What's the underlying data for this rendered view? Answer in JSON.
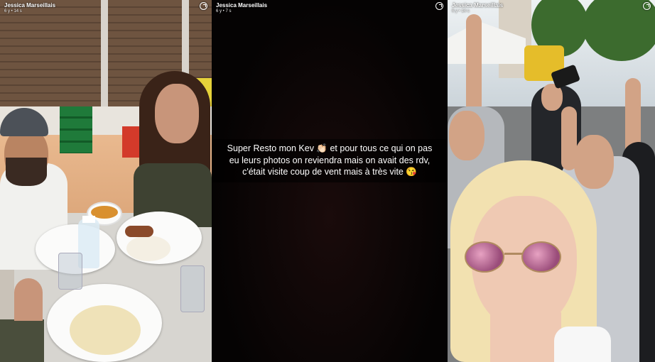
{
  "stories": [
    {
      "username": "Jessica Marseillais",
      "time_ago": "6 y • 14 s"
    },
    {
      "username": "Jessica Marseillais",
      "time_ago": "6 y • 7 s",
      "caption": "Super Resto mon Kev 👏🏻 et pour tous ce qui on pas eu leurs photos on reviendra mais on avait des rdv, c'était visite coup de vent mais à très vite 😘"
    },
    {
      "username": "Jessica Marseillais",
      "time_ago": "6 y • 14 s"
    }
  ],
  "icons": {
    "timer": "timer-icon"
  }
}
